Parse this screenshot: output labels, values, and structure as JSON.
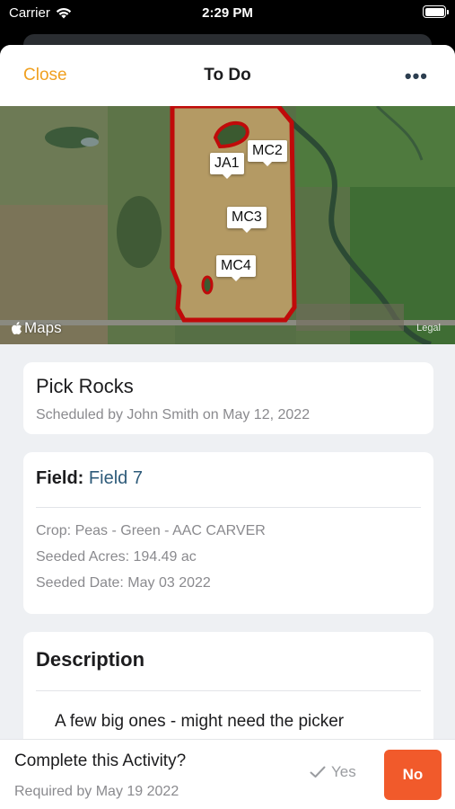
{
  "status_bar": {
    "carrier": "Carrier",
    "time": "2:29 PM"
  },
  "nav": {
    "close_label": "Close",
    "title": "To Do",
    "more_label": "•••"
  },
  "map": {
    "pins": [
      "JA1",
      "MC2",
      "MC3",
      "MC4"
    ],
    "provider": "Maps",
    "legal": "Legal",
    "boundary_color": "#c00a0a"
  },
  "activity": {
    "title": "Pick Rocks",
    "scheduled": "Scheduled by John Smith on May 12, 2022"
  },
  "field": {
    "label": "Field:",
    "name": "Field 7",
    "crop": "Crop: Peas - Green - AAC CARVER",
    "seeded_acres": "Seeded Acres: 194.49 ac",
    "seeded_date": "Seeded Date: May 03 2022"
  },
  "description": {
    "title": "Description",
    "text": "A few big ones - might need the picker"
  },
  "footer": {
    "question": "Complete this Activity?",
    "required": "Required by May 19 2022",
    "yes_label": "Yes",
    "no_label": "No"
  },
  "colors": {
    "accent": "#f0a020",
    "no_button": "#f15a2b",
    "field_name": "#2e5b7a"
  }
}
